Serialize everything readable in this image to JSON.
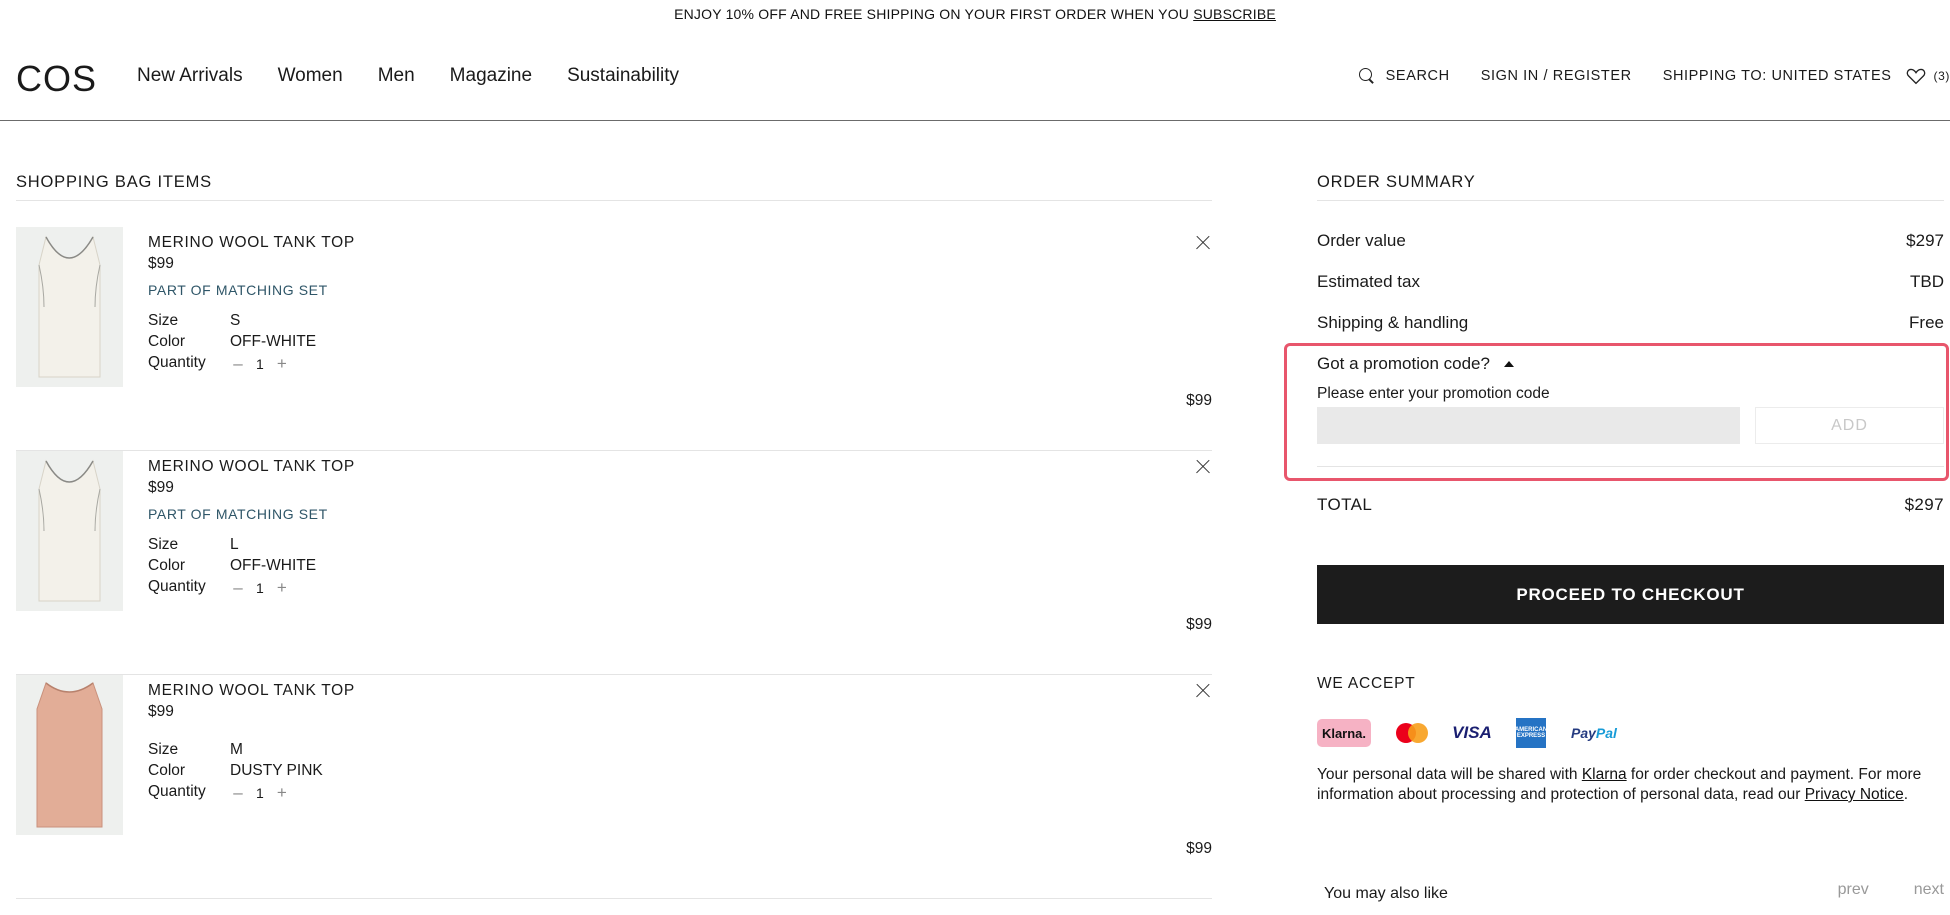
{
  "banner": {
    "text": "ENJOY 10% OFF AND FREE SHIPPING ON YOUR FIRST ORDER WHEN YOU ",
    "link": "SUBSCRIBE"
  },
  "header": {
    "logo": "COS",
    "nav": [
      "New Arrivals",
      "Women",
      "Men",
      "Magazine",
      "Sustainability"
    ],
    "search": "SEARCH",
    "signin": "SIGN IN / REGISTER",
    "shipping": "SHIPPING TO: UNITED STATES",
    "wishlist_count": "(3)"
  },
  "bag": {
    "title": "SHOPPING BAG ITEMS",
    "labels": {
      "size": "Size",
      "color": "Color",
      "quantity": "Quantity"
    },
    "items": [
      {
        "name": "MERINO WOOL TANK TOP",
        "price": "$99",
        "set_label": "PART OF MATCHING SET",
        "size": "S",
        "color": "OFF-WHITE",
        "quantity": "1",
        "total": "$99",
        "swatch": "#f3f1ea"
      },
      {
        "name": "MERINO WOOL TANK TOP",
        "price": "$99",
        "set_label": "PART OF MATCHING SET",
        "size": "L",
        "color": "OFF-WHITE",
        "quantity": "1",
        "total": "$99",
        "swatch": "#f3f1ea"
      },
      {
        "name": "MERINO WOOL TANK TOP",
        "price": "$99",
        "set_label": "",
        "size": "M",
        "color": "DUSTY PINK",
        "quantity": "1",
        "total": "$99",
        "swatch": "#e2ad97"
      }
    ]
  },
  "summary": {
    "title": "ORDER SUMMARY",
    "order_value_label": "Order value",
    "order_value": "$297",
    "tax_label": "Estimated tax",
    "tax": "TBD",
    "shipping_label": "Shipping & handling",
    "shipping": "Free",
    "promo_toggle": "Got a promotion code?",
    "promo_label": "Please enter your promotion code",
    "promo_placeholder": "",
    "promo_add": "ADD",
    "total_label": "TOTAL",
    "total": "$297",
    "checkout": "PROCEED TO CHECKOUT",
    "accept_title": "WE ACCEPT",
    "payments": {
      "klarna": "Klarna.",
      "visa": "VISA",
      "amex": "AMERICAN EXPRESS",
      "paypal_a": "Pay",
      "paypal_b": "Pal"
    },
    "privacy_1": "Your personal data will be shared with ",
    "privacy_link1": "Klarna",
    "privacy_2": " for order checkout and payment. For more information about processing and protection of personal data, read our ",
    "privacy_link2": "Privacy Notice",
    "privacy_3": ".",
    "also_like": "You may also like",
    "prev": "prev",
    "next": "next"
  },
  "colors": {
    "highlight": "#e8566c",
    "set_link": "#2f5668",
    "checkout_bg": "#1c1c1c"
  }
}
